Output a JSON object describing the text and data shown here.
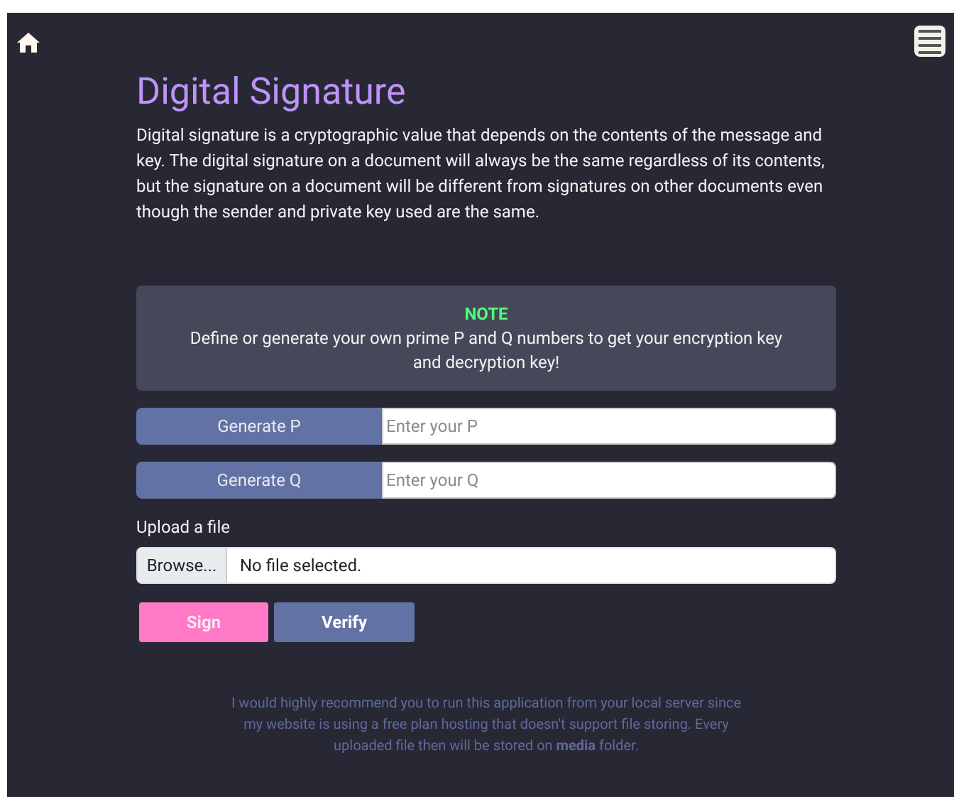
{
  "title": "Digital Signature",
  "description": "Digital signature is a cryptographic value that depends on the contents of the message and key. The digital signature on a document will always be the same regardless of its contents, but the signature on a document will be different from signatures on other documents even though the sender and private key used are the same.",
  "note": {
    "heading": "NOTE",
    "text": "Define or generate your own prime P and Q numbers to get your encryption key and decryption key!"
  },
  "generators": [
    {
      "button": "Generate P",
      "placeholder": "Enter your P"
    },
    {
      "button": "Generate Q",
      "placeholder": "Enter your Q"
    }
  ],
  "upload": {
    "label": "Upload a file",
    "browse": "Browse...",
    "status": "No file selected."
  },
  "actions": [
    {
      "label": "Sign",
      "kind": "primary"
    },
    {
      "label": "Verify",
      "kind": "secondary"
    }
  ],
  "footer": "I would highly recommend you to run this application from your local server since my website is using a free plan hosting that doesn't support file storing. Every uploaded file then will be stored on **media** folder."
}
